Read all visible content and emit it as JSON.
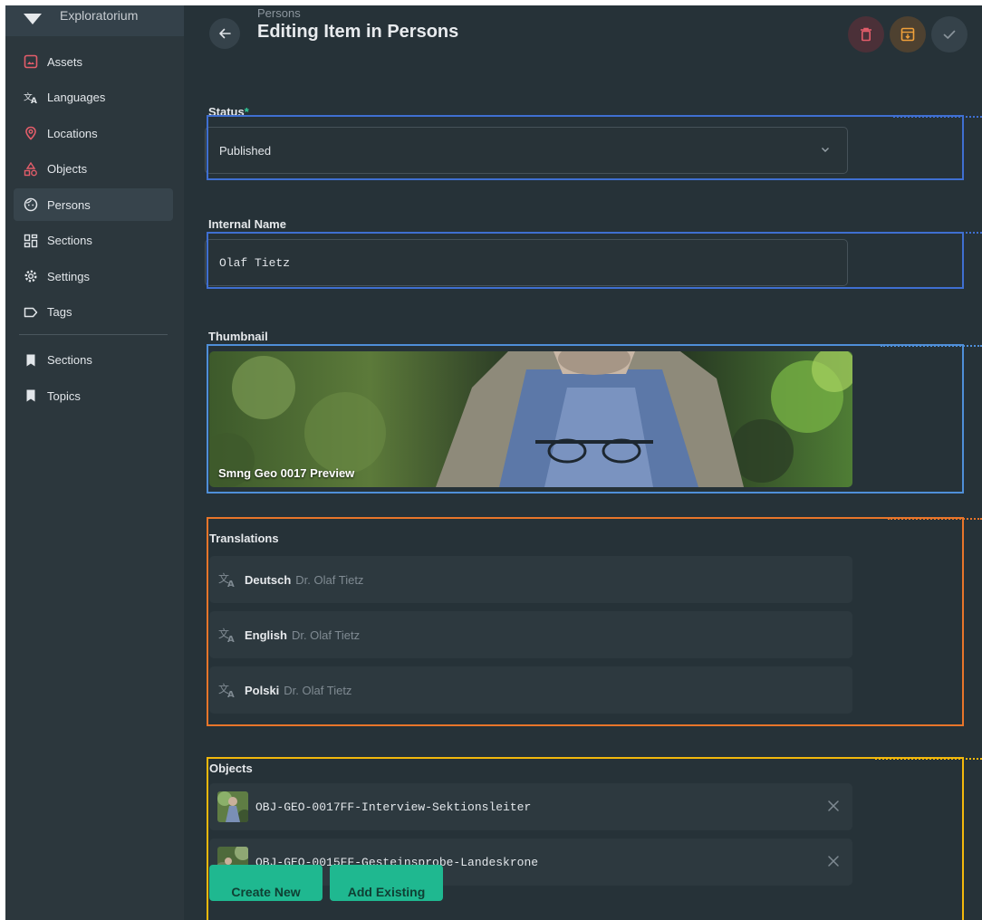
{
  "sidebar": {
    "brand": "Exploratorium",
    "items": [
      {
        "label": "Assets",
        "icon": "image-icon",
        "color": "#e35d6a"
      },
      {
        "label": "Languages",
        "icon": "translate-icon",
        "color": "#e2e6ea"
      },
      {
        "label": "Locations",
        "icon": "map-pin-icon",
        "color": "#e35d6a"
      },
      {
        "label": "Objects",
        "icon": "shapes-icon",
        "color": "#e35d6a"
      },
      {
        "label": "Persons",
        "icon": "face-icon",
        "color": "#e2e6ea",
        "active": true
      },
      {
        "label": "Sections",
        "icon": "grid-icon",
        "color": "#e2e6ea"
      },
      {
        "label": "Settings",
        "icon": "gear-icon",
        "color": "#e2e6ea"
      },
      {
        "label": "Tags",
        "icon": "tag-icon",
        "color": "#e2e6ea"
      }
    ],
    "bookmarks": [
      {
        "label": "Sections",
        "icon": "bookmark-icon"
      },
      {
        "label": "Topics",
        "icon": "bookmark-icon"
      }
    ]
  },
  "header": {
    "breadcrumb": "Persons",
    "title": "Editing Item in Persons",
    "colors": {
      "delete": "#e35d6a",
      "archive": "#f0a03a",
      "save": "#8a949b"
    }
  },
  "form": {
    "status": {
      "label": "Status",
      "required_mark": "*",
      "value": "Published"
    },
    "internal_name": {
      "label": "Internal Name",
      "value": "Olaf Tietz"
    },
    "thumbnail": {
      "label": "Thumbnail",
      "caption": "Smng Geo 0017 Preview"
    },
    "translations": {
      "label": "Translations",
      "items": [
        {
          "language": "Deutsch",
          "value": "Dr. Olaf Tietz"
        },
        {
          "language": "English",
          "value": "Dr. Olaf Tietz"
        },
        {
          "language": "Polski",
          "value": "Dr. Olaf Tietz"
        }
      ]
    },
    "objects": {
      "label": "Objects",
      "items": [
        {
          "name": "OBJ-GEO-0017FF-Interview-Sektionsleiter"
        },
        {
          "name": "OBJ-GEO-0015FF-Gesteinsprobe-Landeskrone"
        }
      ],
      "create_label": "Create New",
      "add_label": "Add Existing"
    }
  },
  "highlight_colors": {
    "blue": "#3f6fd1",
    "light_blue": "#4f8fd8",
    "orange": "#e8752a",
    "yellow": "#f2b80c"
  }
}
